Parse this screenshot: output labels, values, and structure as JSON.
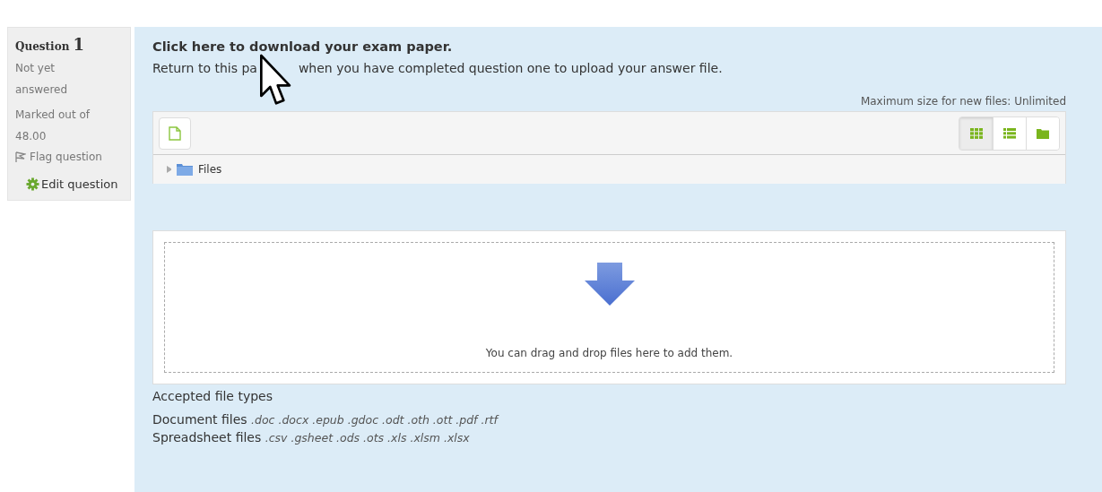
{
  "question_info": {
    "label": "Question",
    "number": "1",
    "state": "Not yet answered",
    "grade": "Marked out of 48.00",
    "flag": {
      "label": "Flag question",
      "flagged": false
    },
    "edit": {
      "label": "Edit question"
    }
  },
  "content": {
    "download_link": "Click here to download your exam paper.",
    "instruction_before_pointer": "Return to this pa",
    "instruction_after_pointer": "when you have completed question one to upload your answer file."
  },
  "file_manager": {
    "max_size": "Maximum size for new files: Unlimited",
    "view_modes": [
      {
        "kind": "grid",
        "selected": true
      },
      {
        "kind": "list",
        "selected": false
      },
      {
        "kind": "tree",
        "selected": false
      }
    ],
    "tree": [
      {
        "label": "Files",
        "expanded": false
      }
    ],
    "dropzone": "You can drag and drop files here to add them."
  },
  "accepted": {
    "title": "Accepted file types",
    "groups": [
      {
        "name": "Document files",
        "extensions": ".doc .docx .epub .gdoc .odt .oth .ott .pdf .rtf"
      },
      {
        "name": "Spreadsheet files",
        "extensions": ".csv .gsheet .ods .ots .xls .xlsm .xlsx"
      }
    ]
  }
}
